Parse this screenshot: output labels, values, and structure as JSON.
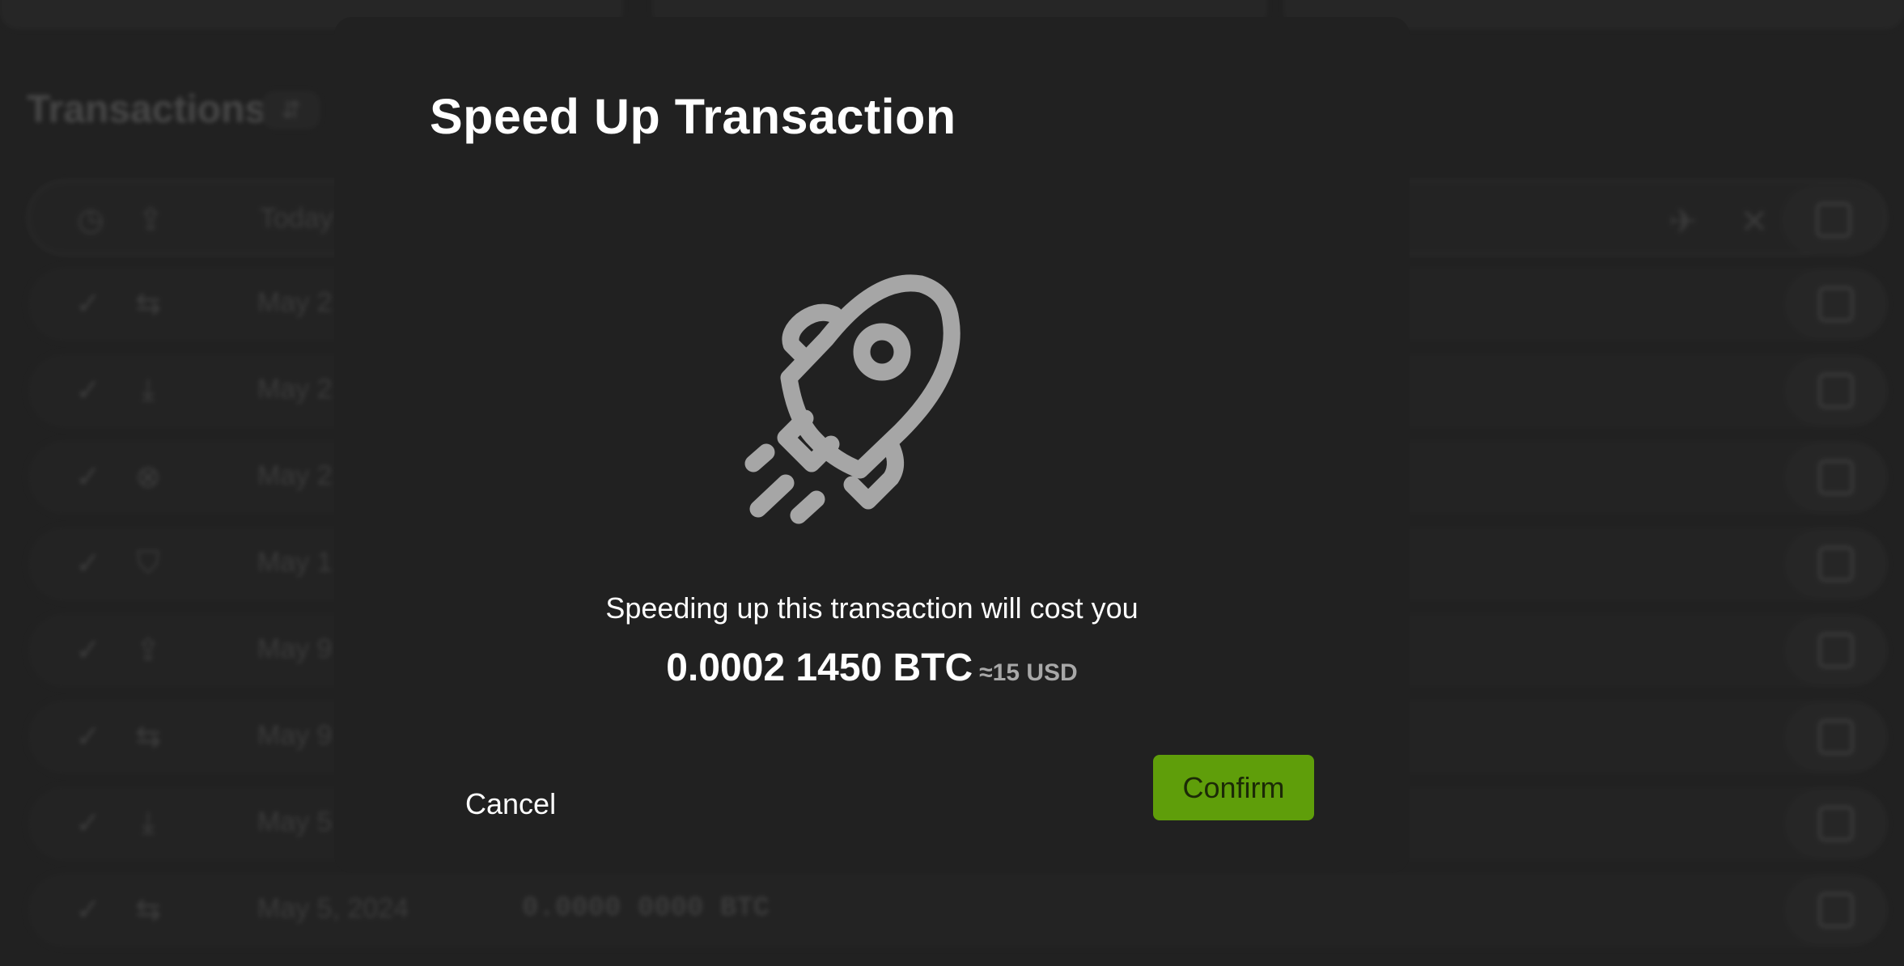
{
  "background": {
    "heading": "Transactions",
    "header_row": {
      "date": "Today"
    },
    "rows": [
      {
        "status_icon": "check-icon",
        "type_icon": "swap-arrows-icon",
        "date": "May 2"
      },
      {
        "status_icon": "check-icon",
        "type_icon": "download-tray-icon",
        "date": "May 2"
      },
      {
        "status_icon": "check-icon",
        "type_icon": "cancel-circle-icon",
        "date": "May 2"
      },
      {
        "status_icon": "check-icon",
        "type_icon": "shield-icon",
        "date": "May 1"
      },
      {
        "status_icon": "check-icon",
        "type_icon": "upload-tray-icon",
        "date": "May 9"
      },
      {
        "status_icon": "check-icon",
        "type_icon": "swap-arrows-icon",
        "date": "May 9"
      },
      {
        "status_icon": "check-icon",
        "type_icon": "download-tray-icon",
        "date": "May 5"
      },
      {
        "status_icon": "check-icon",
        "type_icon": "swap-arrows-icon",
        "date": "May 5, 2024",
        "amount": "0.0000 0000 BTC"
      }
    ]
  },
  "modal": {
    "title": "Speed Up Transaction",
    "icon": "rocket-icon",
    "cost_text": "Speeding up this transaction will cost you",
    "amount_btc": "0.0002 1450 BTC",
    "amount_usd": "≈15 USD",
    "cancel_label": "Cancel",
    "confirm_label": "Confirm",
    "confirm_color": "#5f9e0a"
  }
}
